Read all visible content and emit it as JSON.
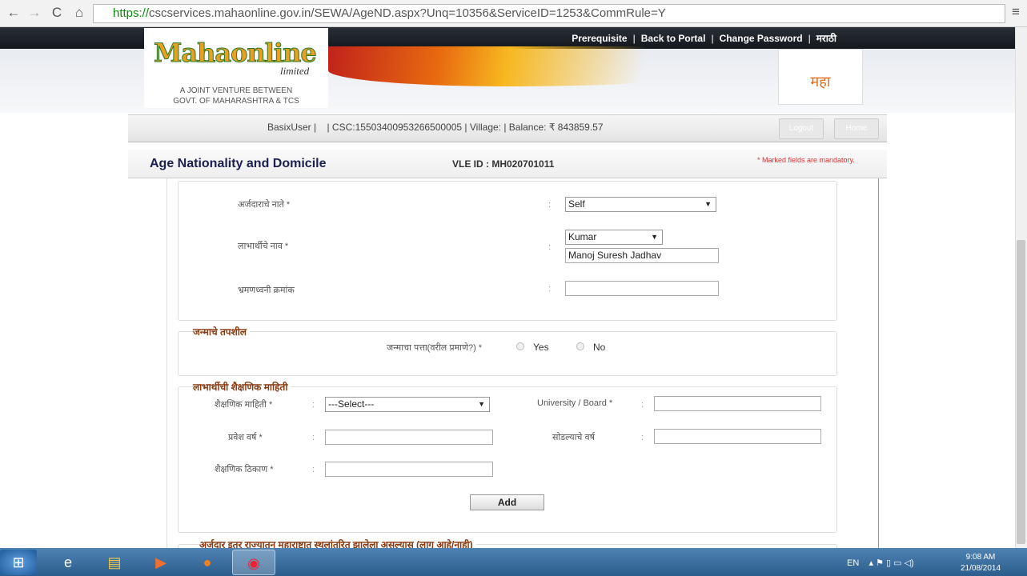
{
  "browser": {
    "url_https": "https://",
    "url_rest": "cscservices.mahaonline.gov.in/SEWA/AgeND.aspx?Unq=10356&ServiceID=1253&CommRule=Y"
  },
  "topnav": {
    "links": [
      "Prerequisite",
      "Back to Portal",
      "Change Password",
      "मराठी"
    ]
  },
  "logo": {
    "brand": "Mahaonline",
    "suffix": "limited",
    "tagline1": "A JOINT VENTURE BETWEEN",
    "tagline2": "GOVT. OF MAHARASHTRA & TCS",
    "right_logo": "महा"
  },
  "userbar": {
    "user": "BasixUser  |",
    "csc": "| CSC:15503400953266500005 | Village:   | Balance: ₹  843859.57",
    "btn1": "Logout",
    "btn2": "Home"
  },
  "title": {
    "page": "Age Nationality and Domicile",
    "vle": "VLE ID : MH020701011",
    "mandatory": "* Marked fields are mandatory."
  },
  "form": {
    "relation_label": "अर्जदाराचे नाते *",
    "relation_value": "Self",
    "name_label": "लाभार्थीचे नाव *",
    "title_value": "Kumar",
    "name_value": "Manoj Suresh Jadhav",
    "mobile_label": "भ्रमणध्वनी क्रमांक",
    "mobile_value": "",
    "birth_section": "जन्माचे तपशील",
    "birth_addr_label": "जन्माचा पत्ता(वरील प्रमाणे?) *",
    "yes": "Yes",
    "no": "No",
    "edu_section": "लाभार्थीची शैक्षणिक माहिती",
    "edu_label": "शैक्षणिक माहिती *",
    "edu_value": "---Select---",
    "univ_label": "University / Board *",
    "univ_value": "",
    "entry_label": "प्रवेश वर्ष *",
    "entry_value": "",
    "leave_label": "सोडल्याचे वर्ष",
    "leave_value": "",
    "place_label": "शैक्षणिक ठिकाण *",
    "place_value": "",
    "add": "Add",
    "migr_section": "अर्जदार इतर राज्यातून महाराष्ट्रात स्थलांतरित झालेला असल्यास (लागू आहे/नाही)",
    "colon": ":"
  },
  "taskbar": {
    "lang": "EN",
    "time": "9:08 AM",
    "date": "21/08/2014"
  }
}
